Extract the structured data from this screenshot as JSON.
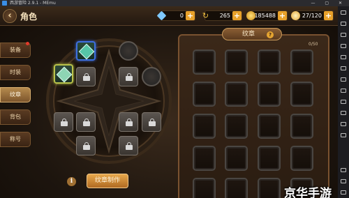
{
  "emulator": {
    "title": "西游冒险 2.9.1 - MEmu"
  },
  "header": {
    "back_icon": "back-arrow-icon",
    "title": "角色"
  },
  "resources": {
    "diamond": {
      "value": "0",
      "icon": "diamond-icon"
    },
    "refresh": {
      "value": "265",
      "icon": "refresh-icon"
    },
    "gold": {
      "value": "185488",
      "icon": "gold-coin-icon"
    },
    "stamina": {
      "value": "27/120",
      "icon": "stamina-icon"
    }
  },
  "tabs": [
    {
      "label": "装备",
      "has_alert": true
    },
    {
      "label": "时装",
      "has_alert": false
    },
    {
      "label": "纹章",
      "active": true
    },
    {
      "label": "背包",
      "has_alert": false
    },
    {
      "label": "称号",
      "has_alert": false
    }
  ],
  "board": {
    "info_icon": "i",
    "make_button": "纹章制作"
  },
  "panel": {
    "title": "纹章",
    "help": "?",
    "count": "0/50"
  },
  "watermark": "京华手游",
  "colors": {
    "accent": "#e8a12a",
    "active_tab": "#b58a4e",
    "panel_border": "#7a5230"
  }
}
